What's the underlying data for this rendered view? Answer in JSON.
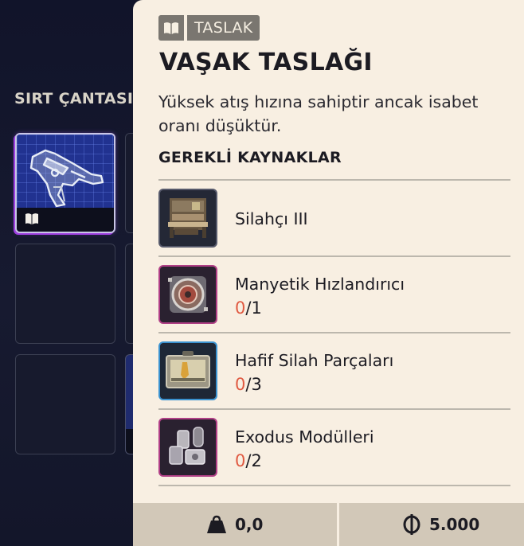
{
  "backpack": {
    "title": "SIRT ÇANTASI"
  },
  "tooltip": {
    "tag_label": "TASLAK",
    "tag_icon": "book-icon",
    "title": "VAŞAK TASLAĞI",
    "description": "Yüksek atış hızına sahiptir ancak isabet oranı düşüktür.",
    "section_title": "GEREKLİ KAYNAKLAR",
    "resources": [
      {
        "name": "Silahçı III",
        "icon": "workbench-icon",
        "rarity": "common"
      },
      {
        "name": "Manyetik Hızlandırıcı",
        "have": "0",
        "need": "/1",
        "icon": "magnetic-accelerator-icon",
        "rarity": "epic"
      },
      {
        "name": "Hafif Silah Parçaları",
        "have": "0",
        "need": "/3",
        "icon": "weapon-parts-case-icon",
        "rarity": "rare"
      },
      {
        "name": "Exodus Modülleri",
        "have": "0",
        "need": "/2",
        "icon": "exodus-modules-icon",
        "rarity": "epic"
      }
    ],
    "footer": {
      "weight": "0,0",
      "weight_icon": "weight-icon",
      "price": "5.000",
      "price_icon": "coin-icon"
    }
  },
  "colors": {
    "panel_bg": "#f8efe2",
    "inventory_bg": "#14172a",
    "missing_count": "#e05a42",
    "rare_border": "#3a92d0",
    "epic_border": "#b03f86"
  }
}
